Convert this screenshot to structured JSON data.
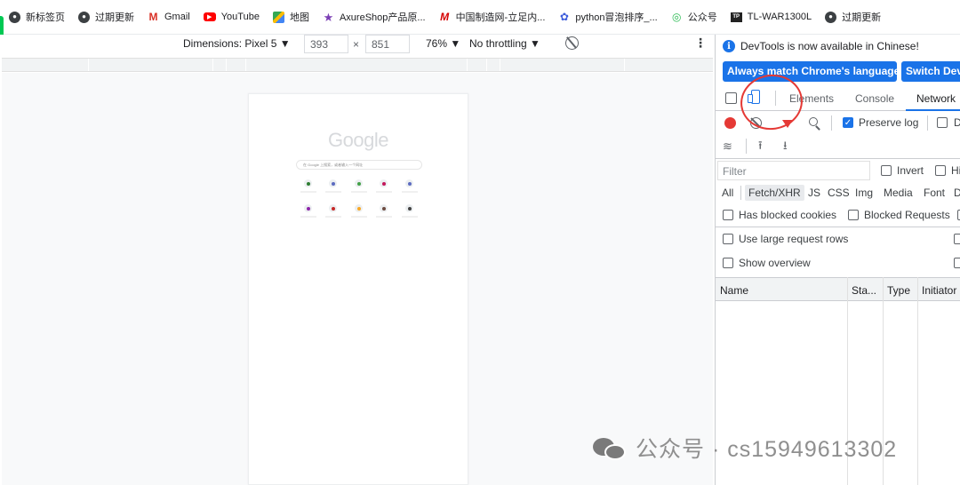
{
  "bookmarks": [
    {
      "label": "新标签页",
      "icon": "globe-icon"
    },
    {
      "label": "过期更新",
      "icon": "globe-icon"
    },
    {
      "label": "Gmail",
      "icon": "gmail-icon"
    },
    {
      "label": "YouTube",
      "icon": "youtube-icon"
    },
    {
      "label": "地图",
      "icon": "maps-icon"
    },
    {
      "label": "AxureShop产品原...",
      "icon": "star-icon"
    },
    {
      "label": "中国制造网-立足内...",
      "icon": "made-in-china-icon"
    },
    {
      "label": "python冒泡排序_...",
      "icon": "baidu-paw-icon"
    },
    {
      "label": "公众号",
      "icon": "wechat-icon"
    },
    {
      "label": "TL-WAR1300L",
      "icon": "tplink-icon"
    },
    {
      "label": "过期更新",
      "icon": "globe-icon"
    }
  ],
  "device_toolbar": {
    "dimensions_label": "Dimensions: Pixel 5 ▼",
    "width": "393",
    "times": "×",
    "height": "851",
    "zoom": "76% ▼",
    "throttling": "No throttling ▼",
    "more": "⋮"
  },
  "phone": {
    "logo": "Google",
    "search_placeholder": "在 Google 上搜索，或者输入一个网址",
    "shortcut_colors": [
      "#2e7d32",
      "#5c6bc0",
      "#43a047",
      "#c2185b",
      "#5c6bc0",
      "#8e24aa",
      "#c62828",
      "#f9a825",
      "#6d4c41",
      "#424242"
    ]
  },
  "devtools": {
    "notice": "DevTools is now available in Chinese!",
    "btn_match": "Always match Chrome's language",
    "btn_switch": "Switch DevTools",
    "tabs": [
      "Elements",
      "Console",
      "Network"
    ],
    "preserve_log": "Preserve log",
    "disable_cache_partial": "D",
    "filter_placeholder": "Filter",
    "invert": "Invert",
    "hide_partial": "Hi",
    "types": [
      "All",
      "Fetch/XHR",
      "JS",
      "CSS",
      "Img",
      "Media",
      "Font",
      "D"
    ],
    "has_blocked_cookies": "Has blocked cookies",
    "blocked_requests": "Blocked Requests",
    "large_rows": "Use large request rows",
    "show_overview": "Show overview",
    "columns": [
      "Name",
      "Sta...",
      "Type",
      "Initiator"
    ]
  },
  "watermark": "公众号 · cs15949613302",
  "colors": {
    "accent": "#1a73e8",
    "record": "#e53935",
    "annotation": "#e53935"
  }
}
